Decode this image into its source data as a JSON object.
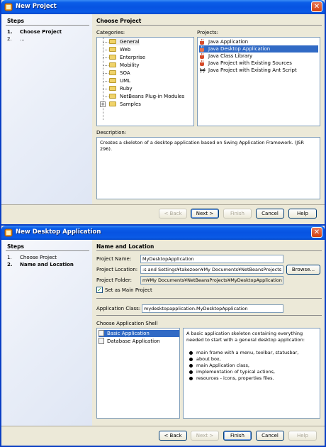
{
  "window1": {
    "title": "New Project",
    "steps_title": "Steps",
    "steps": [
      {
        "num": "1.",
        "label": "Choose Project"
      },
      {
        "num": "2.",
        "label": "..."
      }
    ],
    "main_title": "Choose Project",
    "categories_label": "Categories:",
    "categories": [
      "General",
      "Web",
      "Enterprise",
      "Mobility",
      "SOA",
      "UML",
      "Ruby",
      "NetBeans Plug-in Modules",
      "Samples"
    ],
    "projects_label": "Projects:",
    "projects": [
      "Java Application",
      "Java Desktop Application",
      "Java Class Library",
      "Java Project with Existing Sources",
      "Java Project with Existing Ant Script"
    ],
    "selected_project": "Java Desktop Application",
    "description_label": "Description:",
    "description": "Creates a skeleton of a desktop application based on Swing Application Framework. (JSR 296).",
    "buttons": {
      "back": "< Back",
      "next": "Next >",
      "finish": "Finish",
      "cancel": "Cancel",
      "help": "Help"
    }
  },
  "window2": {
    "title": "New Desktop Application",
    "steps_title": "Steps",
    "steps": [
      {
        "num": "1.",
        "label": "Choose Project"
      },
      {
        "num": "2.",
        "label": "Name and Location"
      }
    ],
    "main_title": "Name and Location",
    "project_name_label": "Project Name:",
    "project_name": "MyDesktopApplication",
    "project_location_label": "Project Location:",
    "project_location": ":s and Settings¥takezoen¥My Documents¥NetBeansProjects",
    "browse": "Browse...",
    "project_folder_label": "Project Folder:",
    "project_folder": "m¥My Documents¥NetBeansProjects¥MyDesktopApplication",
    "set_main_label": "Set as Main Project",
    "set_main_checked": true,
    "app_class_label": "Application Class:",
    "app_class": "mydesktopapplication.MyDesktopApplication",
    "shell_label": "Choose Application Shell",
    "shells": [
      "Basic Application",
      "Database Application"
    ],
    "shell_desc_intro": "A basic application skeleton containing everything needed to start with a general desktop application:",
    "shell_desc_bullets": [
      "main frame with a menu, toolbar, statusbar,",
      "about box,",
      "main Application class,",
      "implementation of typical actions,",
      "resources - icons, properties files."
    ],
    "buttons": {
      "back": "< Back",
      "next": "Next >",
      "finish": "Finish",
      "cancel": "Cancel",
      "help": "Help"
    }
  },
  "colors": {
    "title_bar": "#0753e2",
    "selection": "#316ac5",
    "dialog_bg": "#ece9d8"
  }
}
